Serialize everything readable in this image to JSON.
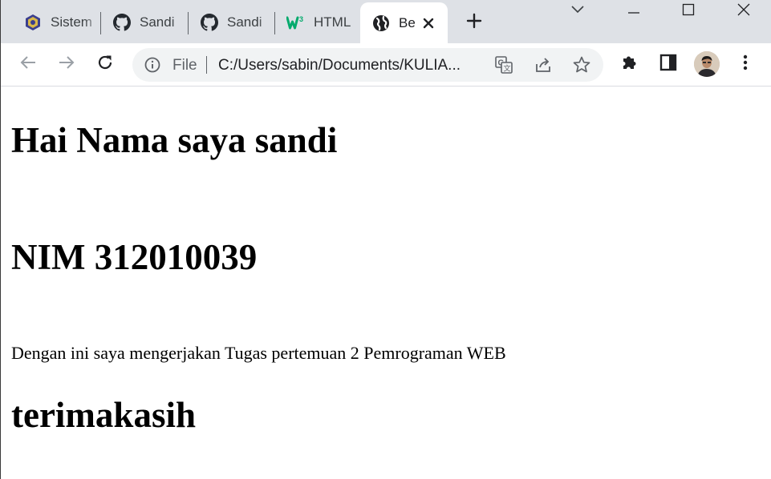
{
  "browser": {
    "tabs": [
      {
        "title": "Sistem",
        "icon": "university-logo-icon"
      },
      {
        "title": "Sandi",
        "icon": "github-icon"
      },
      {
        "title": "Sandi",
        "icon": "github-icon"
      },
      {
        "title": "HTML",
        "icon": "w3schools-icon"
      },
      {
        "title": "Be",
        "icon": "globe-icon",
        "active": true
      }
    ],
    "address_bar": {
      "scheme_label": "File",
      "url": "C:/Users/sabin/Documents/KULIA..."
    }
  },
  "page": {
    "heading_name": "Hai Nama saya sandi",
    "heading_nim": "NIM 312010039",
    "paragraph": "Dengan ini saya mengerjakan Tugas pertemuan 2 Pemrograman WEB",
    "heading_thanks": "terimakasih"
  },
  "colors": {
    "tabstrip_bg": "#dee1e6",
    "omnibox_bg": "#f1f3f4",
    "icon_gray": "#5f6368",
    "w3schools_green": "#04aa6d"
  }
}
